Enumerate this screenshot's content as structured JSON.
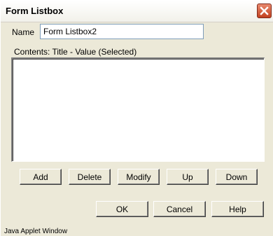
{
  "window": {
    "title": "Form Listbox",
    "close_icon": "close-x-icon"
  },
  "form": {
    "name_label": "Name",
    "name_value": "Form Listbox2",
    "contents_label": "Contents:  Title - Value (Selected)",
    "list_items": []
  },
  "list_buttons": {
    "add": "Add",
    "delete": "Delete",
    "modify": "Modify",
    "up": "Up",
    "down": "Down"
  },
  "dialog_buttons": {
    "ok": "OK",
    "cancel": "Cancel",
    "help": "Help"
  },
  "status": {
    "text": "Java Applet Window"
  },
  "colors": {
    "face": "#ece9d8",
    "close_button": "#c2401f"
  }
}
